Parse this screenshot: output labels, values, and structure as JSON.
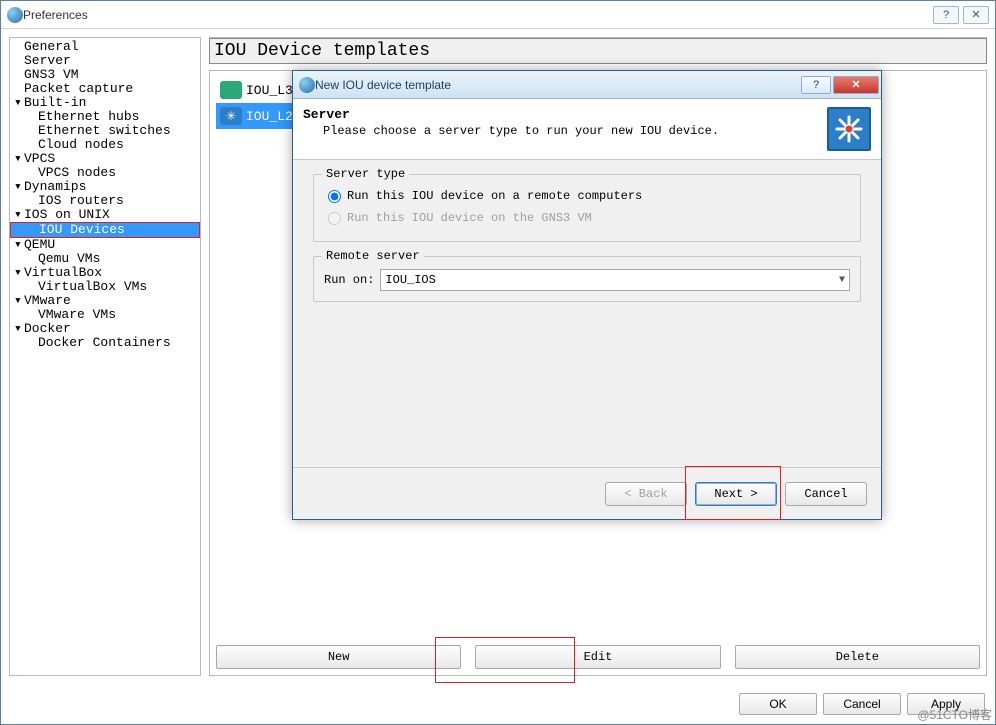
{
  "window": {
    "title": "Preferences"
  },
  "tree": {
    "items": [
      {
        "label": "General",
        "children": []
      },
      {
        "label": "Server",
        "children": []
      },
      {
        "label": "GNS3 VM",
        "children": []
      },
      {
        "label": "Packet capture",
        "children": []
      },
      {
        "label": "Built-in",
        "children": [
          "Ethernet hubs",
          "Ethernet switches",
          "Cloud nodes"
        ]
      },
      {
        "label": "VPCS",
        "children": [
          "VPCS nodes"
        ]
      },
      {
        "label": "Dynamips",
        "children": [
          "IOS routers"
        ]
      },
      {
        "label": "IOS on UNIX",
        "children": [
          "IOU Devices"
        ],
        "selected_child": 0
      },
      {
        "label": "QEMU",
        "children": [
          "Qemu VMs"
        ]
      },
      {
        "label": "VirtualBox",
        "children": [
          "VirtualBox VMs"
        ]
      },
      {
        "label": "VMware",
        "children": [
          "VMware VMs"
        ]
      },
      {
        "label": "Docker",
        "children": [
          "Docker Containers"
        ]
      }
    ]
  },
  "main": {
    "title": "IOU Device templates",
    "devices": [
      {
        "label": "IOU_L3",
        "icon": "router"
      },
      {
        "label": "IOU_L2",
        "icon": "switch",
        "selected": true
      }
    ],
    "buttons": {
      "new": "New",
      "edit": "Edit",
      "delete": "Delete"
    }
  },
  "footer": {
    "ok": "OK",
    "cancel": "Cancel",
    "apply": "Apply"
  },
  "modal": {
    "title": "New IOU device template",
    "header": {
      "h1": "Server",
      "h2": "Please choose a server type to run your new IOU device."
    },
    "server_type": {
      "legend": "Server type",
      "opt_remote": "Run this IOU device on a remote computers",
      "opt_gns3vm": "Run this IOU device on the GNS3 VM",
      "selected": "remote"
    },
    "remote": {
      "legend": "Remote server",
      "run_on_label": "Run on:",
      "run_on_value": "IOU_IOS"
    },
    "buttons": {
      "back": "< Back",
      "next": "Next >",
      "cancel": "Cancel"
    }
  },
  "watermark": "@51CTO博客"
}
